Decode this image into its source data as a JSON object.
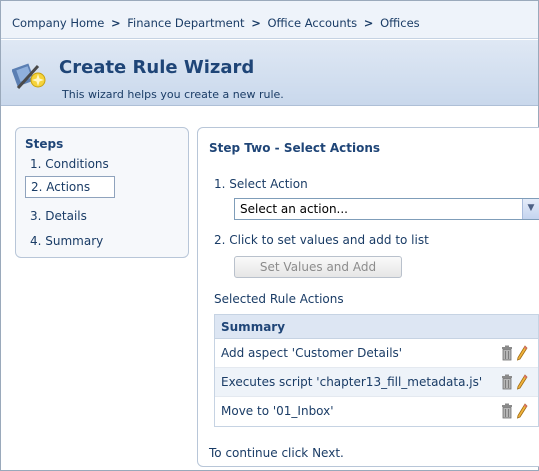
{
  "breadcrumb": {
    "items": [
      "Company Home",
      "Finance Department",
      "Office Accounts",
      "Offices"
    ],
    "separator": ">"
  },
  "header": {
    "title": "Create Rule Wizard",
    "subtitle": "This wizard helps you create a new rule.",
    "icon": "wizard-icon"
  },
  "steps": {
    "title": "Steps",
    "items": [
      "1. Conditions",
      "2. Actions",
      "3. Details",
      "4. Summary"
    ],
    "active_index": 1
  },
  "main": {
    "heading": "Step Two - Select Actions",
    "select_action_label": "1. Select Action",
    "select_value": "Select an action...",
    "click_to_set_label": "2. Click to set values and add to list",
    "set_values_button": "Set Values and Add",
    "selected_rule_actions_label": "Selected Rule Actions",
    "table": {
      "header": "Summary",
      "rows": [
        "Add aspect 'Customer Details'",
        "Executes script 'chapter13_fill_metadata.js'",
        "Move to '01_Inbox'"
      ]
    },
    "footer": "To continue click Next."
  },
  "colors": {
    "title": "#1f4577",
    "text": "#1a3c66",
    "header_bg": "#c9d8ec",
    "table_header_bg": "#dde6f3"
  }
}
